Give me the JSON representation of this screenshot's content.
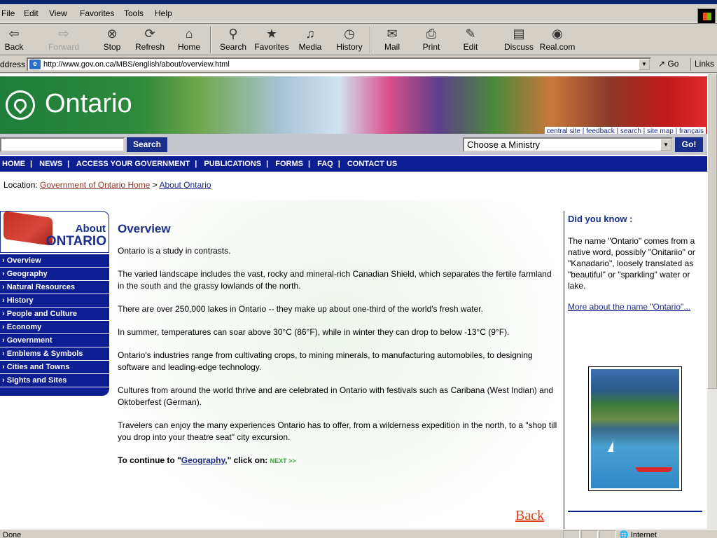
{
  "window": {
    "title": ""
  },
  "menu": [
    "File",
    "Edit",
    "View",
    "Favorites",
    "Tools",
    "Help"
  ],
  "toolbar": [
    {
      "label": "Back",
      "icon": "back-arrow-icon",
      "glyph": "⇦"
    },
    {
      "label": "Forward",
      "icon": "forward-arrow-icon",
      "glyph": "⇨"
    },
    {
      "label": "Stop",
      "icon": "stop-icon",
      "glyph": "⊗"
    },
    {
      "label": "Refresh",
      "icon": "refresh-icon",
      "glyph": "⟳"
    },
    {
      "label": "Home",
      "icon": "home-icon",
      "glyph": "⌂"
    },
    {
      "label": "Search",
      "icon": "search-icon",
      "glyph": "⚲"
    },
    {
      "label": "Favorites",
      "icon": "favorites-icon",
      "glyph": "★"
    },
    {
      "label": "Media",
      "icon": "media-icon",
      "glyph": "♫"
    },
    {
      "label": "History",
      "icon": "history-icon",
      "glyph": "◷"
    },
    {
      "label": "Mail",
      "icon": "mail-icon",
      "glyph": "✉"
    },
    {
      "label": "Print",
      "icon": "print-icon",
      "glyph": "⎙"
    },
    {
      "label": "Edit",
      "icon": "edit-icon",
      "glyph": "✎"
    },
    {
      "label": "Discuss",
      "icon": "discuss-icon",
      "glyph": "▤"
    },
    {
      "label": "Real.com",
      "icon": "realcom-icon",
      "glyph": "◉"
    }
  ],
  "address": {
    "label": "ddress",
    "url": "http://www.gov.on.ca/MBS/english/about/overview.html",
    "go": "Go",
    "links": "Links"
  },
  "status": {
    "text": "Done",
    "zone": "Internet"
  },
  "page": {
    "logo_text": "Ontario",
    "toplinks": [
      "central site",
      "feedback",
      "search",
      "site map",
      "français"
    ],
    "search_button": "Search",
    "ministry_select": "Choose a Ministry",
    "go_button": "Go!",
    "nav": [
      "HOME",
      "NEWS",
      "ACCESS YOUR GOVERNMENT",
      "PUBLICATIONS",
      "FORMS",
      "FAQ",
      "CONTACT US"
    ],
    "location_label": "Location:",
    "crumb_home": "Government of Ontario Home",
    "crumb_sep": ">",
    "crumb_current": "About Ontario",
    "left_head_about": "About",
    "left_head_ontario": "ONTARIO",
    "left_nav": [
      "Overview",
      "Geography",
      "Natural Resources",
      "History",
      "People and Culture",
      "Economy",
      "Government",
      "Emblems & Symbols",
      "Cities and Towns",
      "Sights and Sites"
    ],
    "heading": "Overview",
    "paragraphs": [
      "Ontario is a study in contrasts.",
      "The varied landscape includes the vast, rocky and mineral-rich Canadian Shield, which separates the fertile farmland in the south and the grassy lowlands of the north.",
      "There are over 250,000 lakes in Ontario -- they make up about one-third of the world's fresh water.",
      "In summer, temperatures can soar above 30°C (86°F), while in winter they can drop to below -13°C (9°F).",
      "Ontario's industries range from cultivating crops, to mining minerals, to manufacturing automobiles, to designing software and leading-edge technology.",
      "Cultures from around the world thrive and are celebrated in Ontario with festivals such as Caribana (West Indian) and Oktoberfest (German).",
      "Travelers can enjoy the many experiences Ontario has to offer, from a wilderness expedition in the north, to a \"shop till you drop into your theatre seat\" city excursion."
    ],
    "continue_pre": "To continue to \"",
    "continue_link": "Geography",
    "continue_post": ",\" click on:",
    "next_label": "NEXT >>",
    "back_link": "Back",
    "did_you_know_title": "Did you know :",
    "did_you_know_text": "The name \"Ontario\" comes from a native word, possibly \"Onitariio\" or \"Kanadario\", loosely translated as \"beautiful\" or \"sparkling\" water or lake.",
    "more_link": "More about the name \"Ontario\"..."
  }
}
